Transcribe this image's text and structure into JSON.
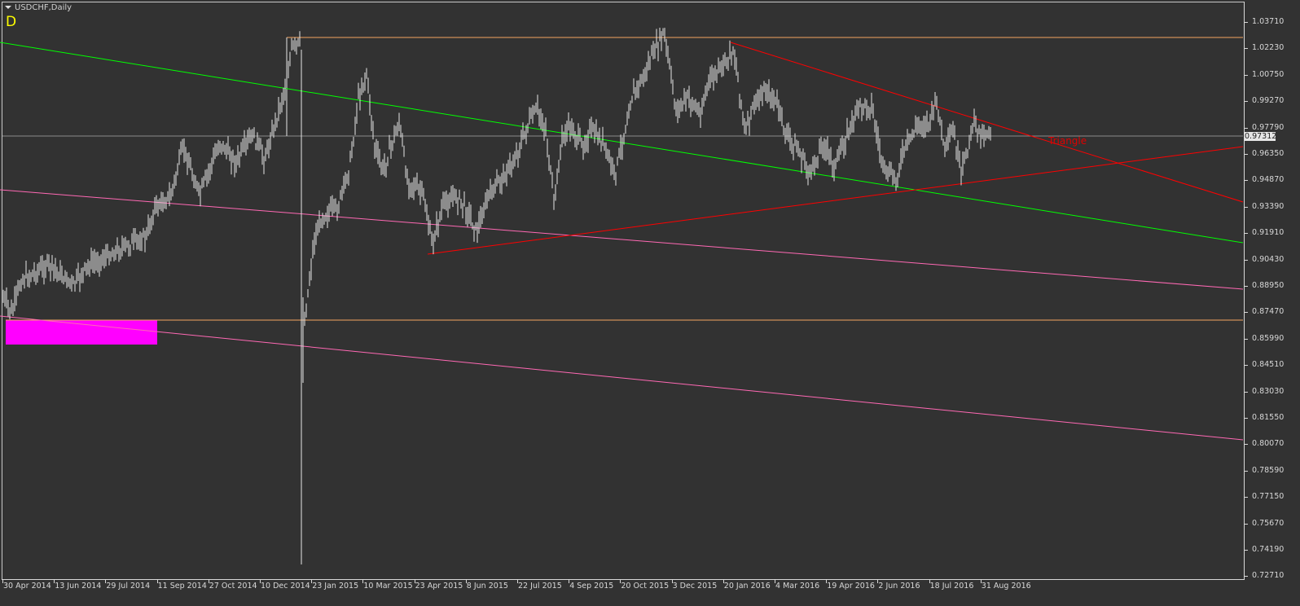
{
  "chart": {
    "symbol_title": "USDCHF,Daily",
    "period_letter": "D",
    "current_price": "0.97312",
    "annotation": "Triangle",
    "price_ticks": [
      "1.03710",
      "1.02230",
      "1.00750",
      "0.99270",
      "0.97790",
      "0.96350",
      "0.94870",
      "0.93390",
      "0.91910",
      "0.90430",
      "0.88950",
      "0.87470",
      "0.85990",
      "0.84510",
      "0.83030",
      "0.81550",
      "0.80070",
      "0.78590",
      "0.77150",
      "0.75670",
      "0.74190",
      "0.72710"
    ],
    "date_ticks": [
      "30 Apr 2014",
      "13 Jun 2014",
      "29 Jul 2014",
      "11 Sep 2014",
      "27 Oct 2014",
      "10 Dec 2014",
      "23 Jan 2015",
      "10 Mar 2015",
      "23 Apr 2015",
      "8 Jun 2015",
      "22 Jul 2015",
      "4 Sep 2015",
      "20 Oct 2015",
      "3 Dec 2015",
      "20 Jan 2016",
      "4 Mar 2016",
      "19 Apr 2016",
      "2 Jun 2016",
      "18 Jul 2016",
      "31 Aug 2016"
    ],
    "colors": {
      "background": "#323232",
      "bars": "#e6e6e6",
      "green_line": "#00ff00",
      "pink_line": "#ff69b4",
      "triangle": "#ff0000",
      "level": "#f4a460",
      "zone": "#ff00ff"
    }
  }
}
